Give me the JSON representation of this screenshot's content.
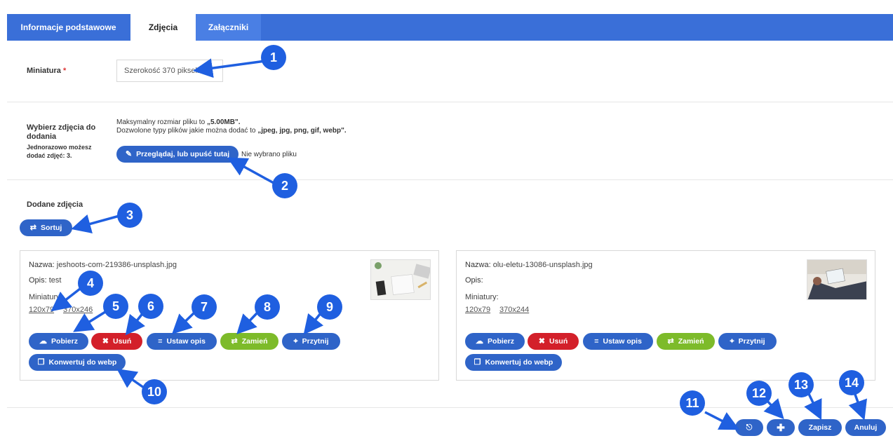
{
  "tabs": [
    {
      "label": "Informacje podstawowe"
    },
    {
      "label": "Zdjęcia"
    },
    {
      "label": "Załączniki"
    }
  ],
  "thumbnail": {
    "label": "Miniatura",
    "required_mark": "*",
    "value": "Szerokość 370 pikseli"
  },
  "upload": {
    "label": "Wybierz zdjęcia do dodania",
    "note_prefix": "Jednorazowo możesz dodać zdjęć:",
    "note_count": "3.",
    "max_size_prefix": "Maksymalny rozmiar pliku to",
    "max_size": "„5.00MB\".",
    "types_prefix": "Dozwolone typy plików jakie można dodać to",
    "types": "„jpeg, jpg, png, gif, webp\".",
    "browse_label": "Przeglądaj, lub upuść tutaj",
    "no_file": "Nie wybrano pliku"
  },
  "added": {
    "label": "Dodane zdjęcia",
    "sort_label": "Sortuj"
  },
  "photos": [
    {
      "name_label": "Nazwa:",
      "name": "jeshoots-com-219386-unsplash.jpg",
      "desc_label": "Opis:",
      "desc": "test",
      "thumbs_label": "Miniatury:",
      "sizes": [
        "120x79",
        "370x246"
      ]
    },
    {
      "name_label": "Nazwa:",
      "name": "olu-eletu-13086-unsplash.jpg",
      "desc_label": "Opis:",
      "desc": "",
      "thumbs_label": "Miniatury:",
      "sizes": [
        "120x79",
        "370x244"
      ]
    }
  ],
  "actions": {
    "download": "Pobierz",
    "delete": "Usuń",
    "set_desc": "Ustaw opis",
    "replace": "Zamień",
    "crop": "Przytnij",
    "convert": "Konwertuj do webp"
  },
  "footer": {
    "save": "Zapisz",
    "cancel": "Anuluj"
  },
  "callouts": [
    "1",
    "2",
    "3",
    "4",
    "5",
    "6",
    "7",
    "8",
    "9",
    "10",
    "11",
    "12",
    "13",
    "14"
  ],
  "colors": {
    "primary": "#2f64c8",
    "topbar": "#3a6fd8",
    "danger": "#d3202a",
    "success": "#7dbb2a",
    "callout": "#1f5fe0"
  }
}
